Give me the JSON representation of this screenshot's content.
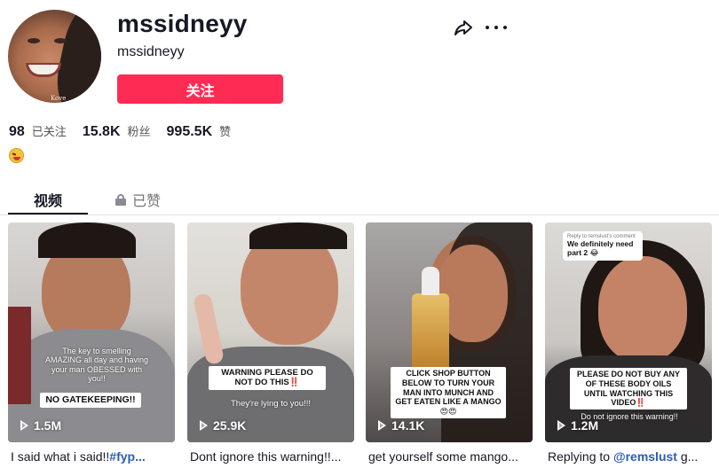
{
  "profile": {
    "username": "mssidneyy",
    "nickname": "mssidneyy",
    "follow_label": "关注",
    "avatar_tag": "Kove",
    "bio_emoji_icon": "laughing-face-emoji-icon"
  },
  "stats": [
    {
      "value": "98",
      "label": "已关注"
    },
    {
      "value": "15.8K",
      "label": "粉丝"
    },
    {
      "value": "995.5K",
      "label": "赞"
    }
  ],
  "tabs": {
    "videos": "视频",
    "liked": "已赞"
  },
  "colors": {
    "accent": "#fe2c55",
    "text": "#161823",
    "link": "#2b5db9"
  },
  "videos": [
    {
      "views": "1.5M",
      "overlay_text": "The key to smelling AMAZING all day and having your man OBESSED with you!!",
      "caption_box": "NO GATEKEEPING!!",
      "desc_text": "I said what i said!!",
      "desc_tag": "#fyp..."
    },
    {
      "views": "25.9K",
      "caption_box": "WARNING PLEASE DO NOT DO THIS‼️",
      "overlay_text": "They're lying to you!!!",
      "desc_text": "Dont ignore this warning!!..."
    },
    {
      "views": "14.1K",
      "caption_box": "CLICK SHOP BUTTON BELOW TO TURN YOUR MAN INTO MUNCH AND GET EATEN LIKE A MANGO😍😍",
      "desc_text": "get yourself some mango..."
    },
    {
      "views": "1.2M",
      "reply_header": "Reply to remslust's comment",
      "reply_text": "We definitely need part 2 😂",
      "caption_box": "PLEASE DO NOT BUY ANY OF THESE BODY OILS UNTIL WATCHING THIS VIDEO‼️",
      "overlay_text": "Do not ignore this warning!!",
      "desc_text": "Replying to ",
      "desc_mention": "@remslust",
      "desc_tail": " g..."
    }
  ]
}
